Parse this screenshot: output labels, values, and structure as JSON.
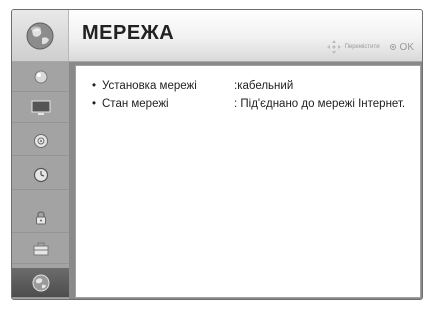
{
  "header": {
    "title": "МЕРЕЖА",
    "hint_move": "Перемістити",
    "hint_ok": "OK",
    "icon": "globe-icon"
  },
  "sidebar": {
    "items": [
      {
        "icon": "picture-icon"
      },
      {
        "icon": "screen-icon"
      },
      {
        "icon": "audio-icon"
      },
      {
        "icon": "clock-icon"
      },
      {
        "icon": "lock-icon"
      },
      {
        "icon": "option-icon"
      },
      {
        "icon": "network-icon",
        "active": true
      }
    ]
  },
  "settings": [
    {
      "bullet": "•",
      "label": "Установка мережі",
      "value": ":кабельний"
    },
    {
      "bullet": "•",
      "label": "Стан мережі",
      "value": ": Під'єднано до мережі Інтернет."
    }
  ],
  "colors": {
    "header_bg": "#f1f1f1",
    "sidebar_bg": "#a3a3a3",
    "sidebar_active": "#555555",
    "frame": "#8a8a8a",
    "text": "#222222"
  }
}
